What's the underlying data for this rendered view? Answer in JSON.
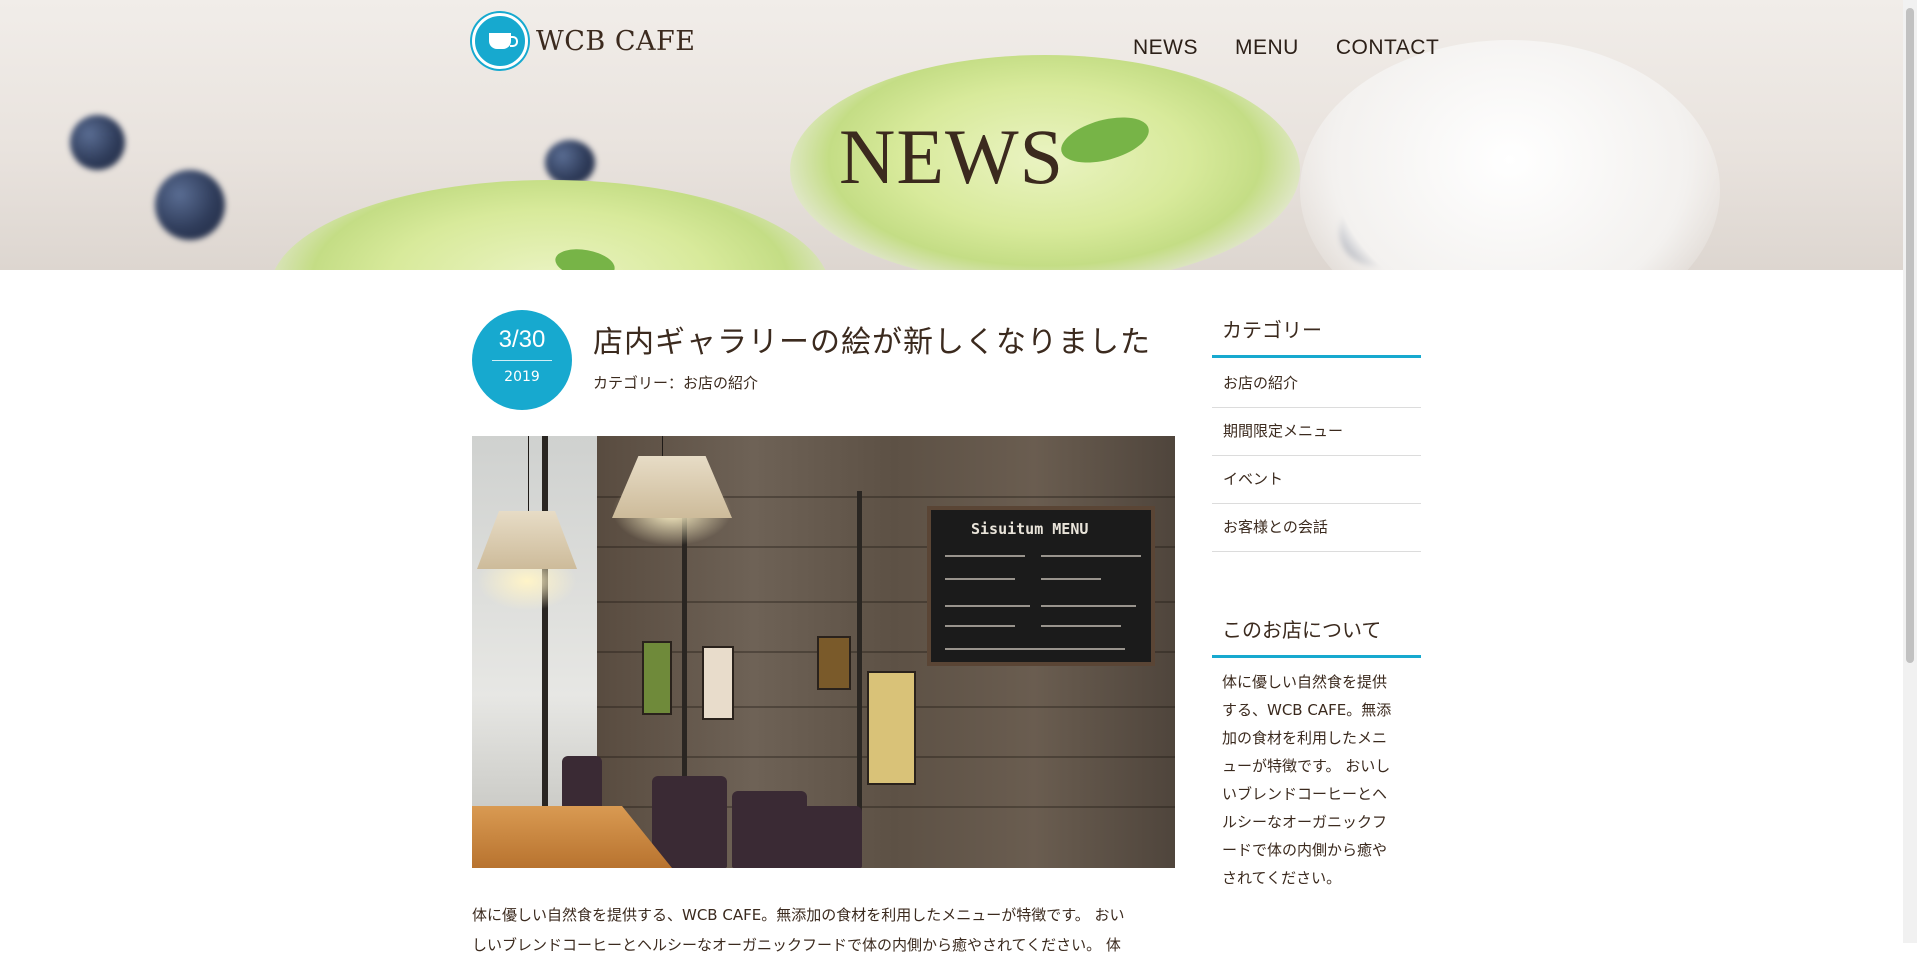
{
  "brand": {
    "name": "WCB CAFE",
    "logo_icon": "cafe-cup-logo"
  },
  "nav": {
    "items": [
      "NEWS",
      "MENU",
      "CONTACT"
    ]
  },
  "hero": {
    "title": "NEWS"
  },
  "post": {
    "date_md": "3/30",
    "date_year": "2019",
    "title": "店内ギャラリーの絵が新しくなりました",
    "category": "カテゴリー：お店の紹介",
    "photo_board_title": "Sisuitum MENU",
    "body_lines": [
      "体に優しい自然食を提供する、WCB CAFE。無添加の食材を利用したメニューが特徴です。 おい",
      "しいブレンドコーヒーとヘルシーなオーガニックフードで体の内側から癒やされてください。 体"
    ]
  },
  "sidebar": {
    "categories_title": "カテゴリー",
    "categories": [
      "お店の紹介",
      "期間限定メニュー",
      "イベント",
      "お客様との会話"
    ],
    "about_title": "このお店について",
    "about_lines": [
      "体に優しい自然食を提供",
      "する、WCB CAFE。無添",
      "加の食材を利用したメニ",
      "ューが特徴です。 おいし",
      "いブレンドコーヒーとヘ",
      "ルシーなオーガニックフ",
      "ードで体の内側から癒や",
      "されてください。"
    ]
  },
  "colors": {
    "accent": "#17a9cf",
    "text": "#3b2a1e"
  }
}
